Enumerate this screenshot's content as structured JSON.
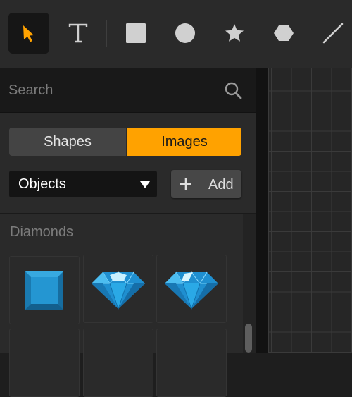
{
  "toolbar": {
    "tools": [
      {
        "name": "select-tool",
        "icon": "arrow-pointer-icon",
        "active": true
      },
      {
        "name": "text-tool",
        "icon": "text-t-icon",
        "active": false
      },
      {
        "name": "rectangle-tool",
        "icon": "square-icon",
        "active": false
      },
      {
        "name": "ellipse-tool",
        "icon": "circle-icon",
        "active": false
      },
      {
        "name": "star-tool",
        "icon": "star-icon",
        "active": false
      },
      {
        "name": "polygon-tool",
        "icon": "hexagon-icon",
        "active": false
      },
      {
        "name": "line-tool",
        "icon": "line-icon",
        "active": false
      }
    ],
    "active_color": "#ffa200"
  },
  "sidebar": {
    "search": {
      "placeholder": "Search",
      "value": ""
    },
    "segments": {
      "shapes": "Shapes",
      "images": "Images",
      "selected": "Images"
    },
    "category_select": {
      "value": "Objects"
    },
    "add_button": {
      "label": "Add"
    },
    "section": {
      "title": "Diamonds",
      "items": [
        {
          "icon": "square-gem-icon",
          "color": "#1d8ec9"
        },
        {
          "icon": "diamond-gem-icon",
          "color": "#2aa9e6"
        },
        {
          "icon": "diamond-gem-icon",
          "color": "#2aa9e6"
        }
      ]
    }
  },
  "colors": {
    "accent": "#ffa200",
    "gem_blue": "#2aa9e6"
  }
}
